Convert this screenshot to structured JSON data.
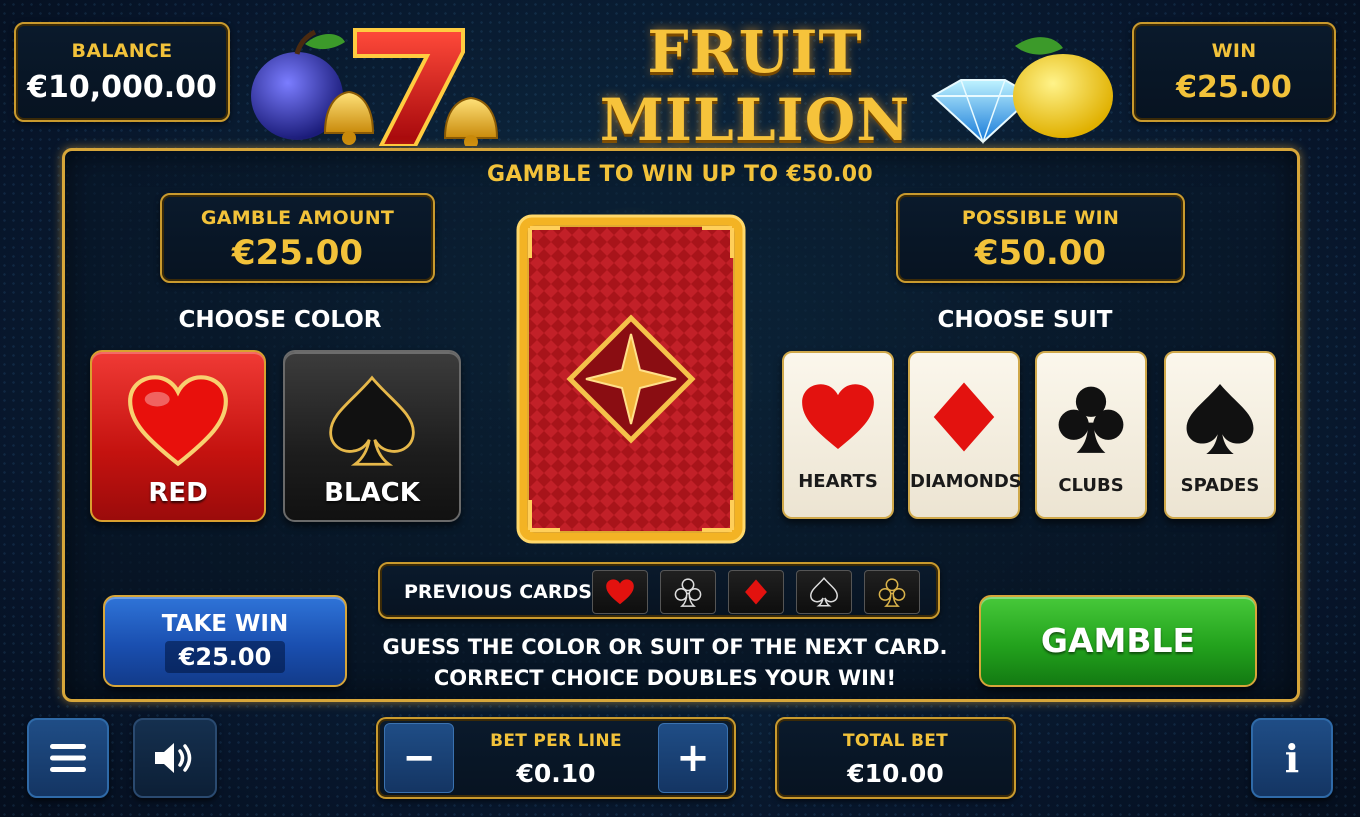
{
  "header": {
    "balance_label": "BALANCE",
    "balance_value": "€10,000.00",
    "win_label": "WIN",
    "win_value": "€25.00",
    "logo_title": "FRUIT MILLION"
  },
  "gamble": {
    "headline": "GAMBLE TO WIN UP TO €50.00",
    "amount_label": "GAMBLE AMOUNT",
    "amount_value": "€25.00",
    "possible_win_label": "POSSIBLE WIN",
    "possible_win_value": "€50.00",
    "choose_color_title": "CHOOSE COLOR",
    "choose_suit_title": "CHOOSE SUIT",
    "colors": [
      {
        "label": "RED",
        "icon": "heart-icon"
      },
      {
        "label": "BLACK",
        "icon": "spade-icon"
      }
    ],
    "suits": [
      {
        "label": "HEARTS",
        "icon": "heart-icon"
      },
      {
        "label": "DIAMONDS",
        "icon": "diamond-icon"
      },
      {
        "label": "CLUBS",
        "icon": "club-icon"
      },
      {
        "label": "SPADES",
        "icon": "spade-icon"
      }
    ],
    "previous_cards_label": "PREVIOUS CARDS",
    "previous_cards": [
      "heart-icon",
      "club-icon",
      "diamond-icon",
      "spade-icon",
      "club-icon"
    ],
    "instructions_line1": "GUESS THE COLOR OR SUIT OF THE NEXT CARD.",
    "instructions_line2": "CORRECT CHOICE DOUBLES YOUR WIN!",
    "take_win_label": "TAKE WIN",
    "take_win_value": "€25.00",
    "gamble_button_label": "GAMBLE"
  },
  "footer": {
    "bet_per_line_label": "BET PER LINE",
    "bet_per_line_value": "€0.10",
    "minus_symbol": "−",
    "plus_symbol": "+",
    "total_bet_label": "TOTAL BET",
    "total_bet_value": "€10.00",
    "info_symbol": "i"
  },
  "colors": {
    "gold": "#f2c23a",
    "red_button": "#c4120f",
    "take_win_blue": "#1a4fb0",
    "gamble_green": "#23a21d"
  }
}
